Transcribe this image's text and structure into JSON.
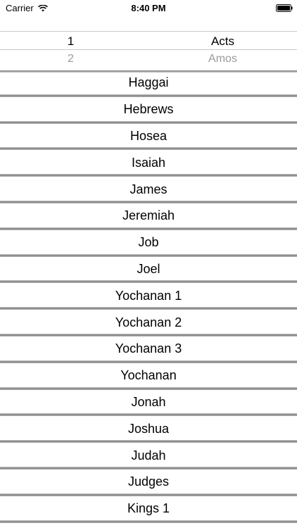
{
  "status": {
    "carrier": "Carrier",
    "time": "8:40 PM",
    "icons": [
      "wifi-icon",
      "battery-icon"
    ]
  },
  "picker": {
    "left_selected": "1",
    "left_next": "2",
    "right_selected": "Acts",
    "right_next": "Amos"
  },
  "books": [
    "Haggai",
    "Hebrews",
    "Hosea",
    "Isaiah",
    "James",
    "Jeremiah",
    "Job",
    "Joel",
    "Yochanan 1",
    "Yochanan 2",
    "Yochanan 3",
    "Yochanan",
    "Jonah",
    "Joshua",
    "Judah",
    "Judges",
    "Kings 1"
  ]
}
